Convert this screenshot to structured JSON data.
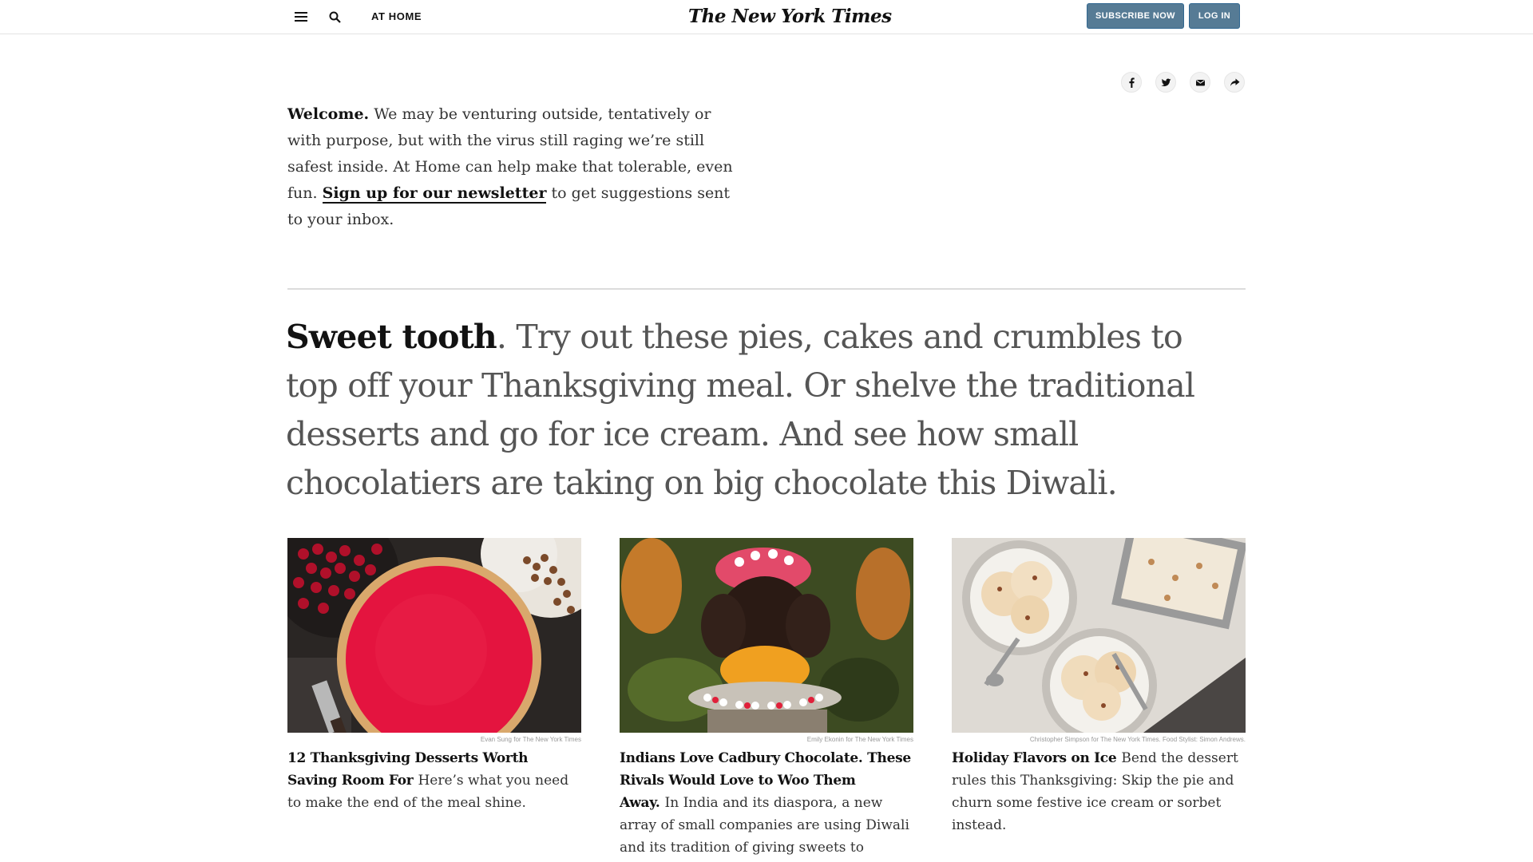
{
  "header": {
    "section_label": "AT HOME",
    "logo_text": "The New York Times",
    "subscribe_label": "SUBSCRIBE NOW",
    "login_label": "LOG IN",
    "icons": [
      "menu-icon",
      "search-icon"
    ],
    "accent_color": "#567b95"
  },
  "share": {
    "icons": [
      "facebook-icon",
      "twitter-icon",
      "email-icon",
      "share-icon"
    ]
  },
  "intro": {
    "welcome": "Welcome.",
    "body": " We may be venturing outside, tentatively or with purpose, but with the virus still raging we’re still safest inside. At Home can help make that tolerable, even fun. ",
    "newsletter_link": "Sign up for our newsletter",
    "tail": " to get suggestions sent to your inbox."
  },
  "headline": {
    "lead": "Sweet tooth",
    "rest": ". Try out these pies, cakes and crumbles to top off your Thanksgiving meal. Or shelve the traditional desserts and go for ice cream. And see how small chocolatiers are taking on big chocolate this Diwali."
  },
  "cards": [
    {
      "credit": "Evan Sung for The New York Times",
      "title": "12 Thanksgiving Desserts Worth Saving Room For",
      "summary": "Here’s what you need to make the end of the meal shine."
    },
    {
      "credit": "Emily Ekonin for The New York Times",
      "title": "Indians Love Cadbury Chocolate. These Rivals Would Love to Woo Them Away.",
      "summary": "In India and its diaspora, a new array of small companies are using Diwali and its tradition of giving sweets to popularize a"
    },
    {
      "credit": "Christopher Simpson for The New York Times. Food Stylist: Simon Andrews.",
      "title": "Holiday Flavors on Ice",
      "summary": "Bend the dessert rules this Thanksgiving: Skip the pie and churn some festive ice cream or sorbet instead."
    }
  ]
}
